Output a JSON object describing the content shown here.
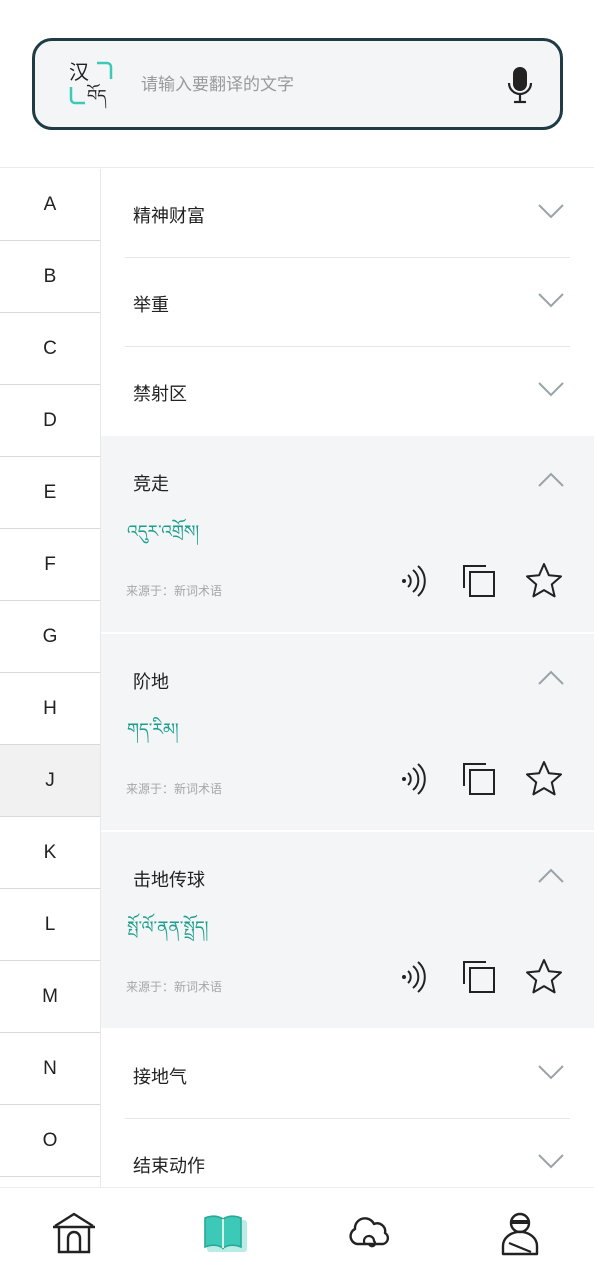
{
  "search": {
    "placeholder": "请输入要翻译的文字",
    "logo_han": "汉",
    "logo_tib": "བོད"
  },
  "alphabet": [
    "A",
    "B",
    "C",
    "D",
    "E",
    "F",
    "G",
    "H",
    "J",
    "K",
    "L",
    "M",
    "N",
    "O"
  ],
  "alphabet_active": "J",
  "entries": [
    {
      "word": "精神财富",
      "expanded": false
    },
    {
      "word": "举重",
      "expanded": false
    },
    {
      "word": "禁射区",
      "expanded": false
    },
    {
      "word": "竞走",
      "expanded": true,
      "tibetan": "འདུར་འགྲོས།",
      "source": "来源于：新词术语"
    },
    {
      "word": "阶地",
      "expanded": true,
      "tibetan": "གད་རིམ།",
      "source": "来源于：新词术语"
    },
    {
      "word": "击地传球",
      "expanded": true,
      "tibetan": "སྤོ་ལོ་ནན་སྤྲོད།",
      "source": "来源于：新词术语"
    },
    {
      "word": "接地气",
      "expanded": false
    },
    {
      "word": "结束动作",
      "expanded": false
    }
  ],
  "nav": [
    {
      "name": "home-icon",
      "active": false
    },
    {
      "name": "dictionary-icon",
      "active": true
    },
    {
      "name": "cloud-icon",
      "active": false
    },
    {
      "name": "profile-icon",
      "active": false
    }
  ],
  "colors": {
    "accent": "#3dc9b7",
    "tibetan_text": "#1b9e8c",
    "border_dark": "#1f3c44"
  }
}
